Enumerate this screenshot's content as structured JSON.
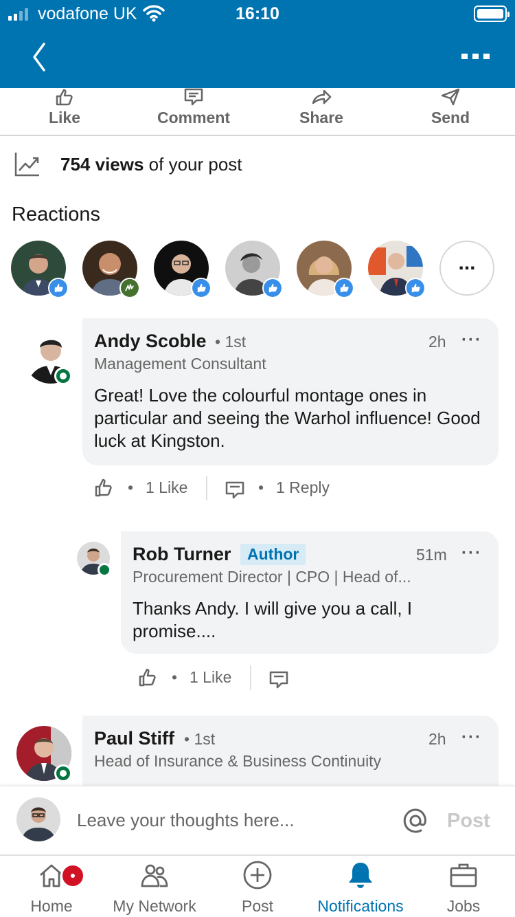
{
  "status_bar": {
    "carrier": "vodafone UK",
    "time": "16:10"
  },
  "header": {
    "back_icon": "chevron-left-icon",
    "more_icon": "more-horizontal-icon"
  },
  "social_actions": [
    {
      "label": "Like",
      "icon": "thumbs-up-icon"
    },
    {
      "label": "Comment",
      "icon": "comment-icon"
    },
    {
      "label": "Share",
      "icon": "share-arrow-icon"
    },
    {
      "label": "Send",
      "icon": "send-icon"
    }
  ],
  "views": {
    "icon": "trending-chart-icon",
    "count": "754 views",
    "suffix": " of your post"
  },
  "reactions": {
    "title": "Reactions",
    "people": [
      {
        "reaction": "like",
        "badge_color": "#378fe9"
      },
      {
        "reaction": "celebrate",
        "badge_color": "#44712e"
      },
      {
        "reaction": "like",
        "badge_color": "#378fe9"
      },
      {
        "reaction": "like",
        "badge_color": "#378fe9"
      },
      {
        "reaction": "like",
        "badge_color": "#378fe9"
      },
      {
        "reaction": "like",
        "badge_color": "#378fe9"
      }
    ],
    "more_label": "..."
  },
  "comments": [
    {
      "name": "Andy Scoble",
      "degree": "• 1st",
      "time": "2h",
      "headline": "Management Consultant",
      "body": "Great!  Love the colourful montage ones in particular and seeing the Warhol influence! Good luck at Kingston.",
      "likes": "1 Like",
      "replies": "1 Reply",
      "more": "···"
    },
    {
      "name": "Rob Turner",
      "author_tag": "Author",
      "time": "51m",
      "headline": "Procurement Director | CPO | Head of...",
      "body": "Thanks Andy. I will give you a call, I promise....",
      "likes": "1 Like",
      "more": "···"
    },
    {
      "name": "Paul Stiff",
      "degree": "• 1st",
      "time": "2h",
      "headline": "Head of Insurance & Business Continuity",
      "more": "···"
    }
  ],
  "dot_separator": "•",
  "composer": {
    "placeholder": "Leave your thoughts here...",
    "at_icon": "at-mention-icon",
    "post_label": "Post"
  },
  "tabs": [
    {
      "label": "Home",
      "icon": "home-icon"
    },
    {
      "label": "My Network",
      "icon": "network-icon"
    },
    {
      "label": "Post",
      "icon": "plus-circle-icon"
    },
    {
      "label": "Notifications",
      "icon": "bell-icon",
      "active": true
    },
    {
      "label": "Jobs",
      "icon": "briefcase-icon"
    }
  ],
  "colors": {
    "brand": "#0073b1",
    "online": "#057642",
    "notification_badge": "#d11124"
  }
}
